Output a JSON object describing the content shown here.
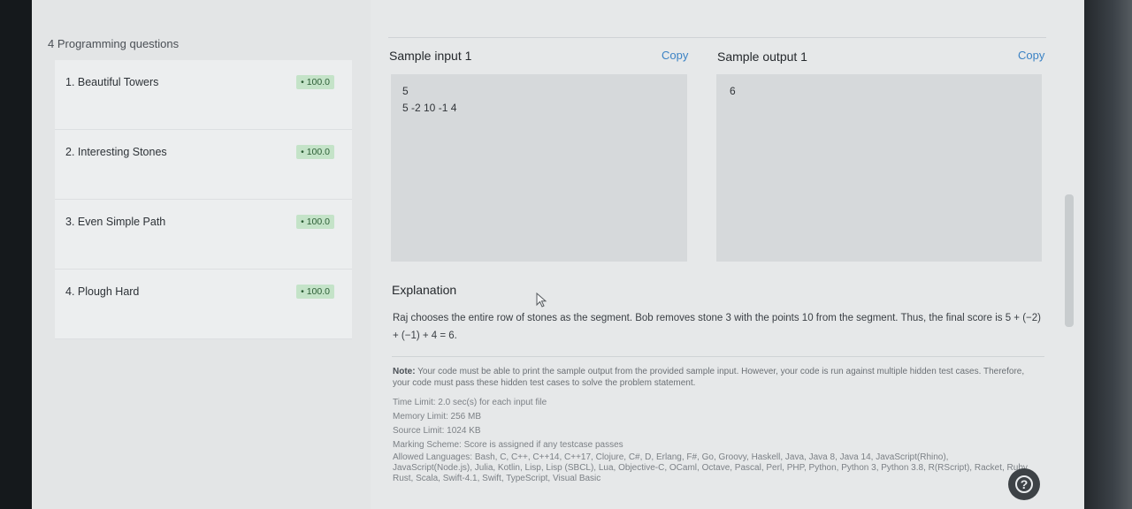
{
  "sidebar": {
    "header": "4 Programming questions",
    "questions": [
      {
        "label": "1. Beautiful Towers",
        "score": "• 100.0"
      },
      {
        "label": "2. Interesting Stones",
        "score": "• 100.0"
      },
      {
        "label": "3. Even Simple Path",
        "score": "• 100.0"
      },
      {
        "label": "4. Plough Hard",
        "score": "• 100.0"
      }
    ]
  },
  "sample_input": {
    "title": "Sample input 1",
    "copy_label": "Copy",
    "lines": [
      "5",
      "5 -2 10 -1 4"
    ]
  },
  "sample_output": {
    "title": "Sample output 1",
    "copy_label": "Copy",
    "lines": [
      "6"
    ]
  },
  "explanation": {
    "title": "Explanation",
    "text": "Raj chooses the entire row of stones as the segment. Bob removes stone 3 with the points 10 from the segment. Thus, the final score is 5 + (−2) + (−1) + 4 = 6."
  },
  "note": {
    "label": "Note:",
    "text": "Your code must be able to print the sample output from the provided sample input. However, your code is run against multiple hidden test cases. Therefore, your code must pass these hidden test cases to solve the problem statement."
  },
  "limits": {
    "time_limit": "Time Limit: 2.0 sec(s) for each input file",
    "memory_limit": "Memory Limit: 256 MB",
    "source_limit": "Source Limit: 1024 KB",
    "marking_scheme": "Marking Scheme: Score is assigned if any testcase passes",
    "allowed_languages": "Allowed Languages: Bash, C, C++, C++14, C++17, Clojure, C#, D, Erlang, F#, Go, Groovy, Haskell, Java, Java 8, Java 14, JavaScript(Rhino), JavaScript(Node.js), Julia, Kotlin, Lisp, Lisp (SBCL), Lua, Objective-C, OCaml, Octave, Pascal, Perl, PHP, Python, Python 3, Python 3.8, R(RScript), Racket, Ruby, Rust, Scala, Swift-4.1, Swift, TypeScript, Visual Basic"
  },
  "help": {
    "icon": "question-icon",
    "glyph": "?"
  },
  "colors": {
    "accent": "#3b82c4",
    "score_badge_bg": "#c4e3c8"
  }
}
